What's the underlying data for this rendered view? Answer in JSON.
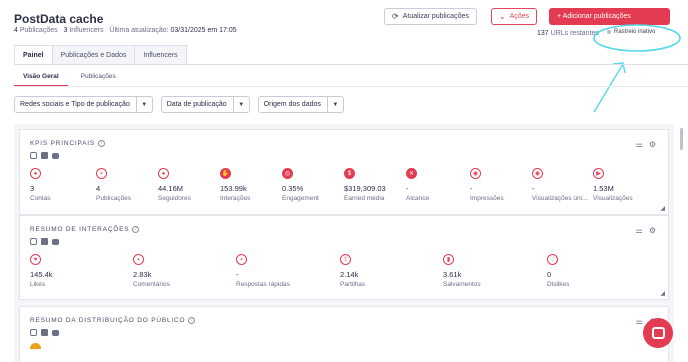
{
  "header": {
    "title": "PostData cache",
    "posts_count": "4",
    "posts_label": "Publicações",
    "influencers_count": "3",
    "influencers_label": "Influencers",
    "last_update_label": "Última atualização:",
    "last_update_value": "03/31/2025 em 17:05"
  },
  "actions": {
    "refresh_label": "Atualizar publicações",
    "actions_label": "Ações",
    "add_label": "+ Adicionar publicações",
    "urls_count": "137",
    "urls_label": "URLs restantes",
    "tracking_label": "Rastreio inativo"
  },
  "tabs": [
    {
      "label": "Painel"
    },
    {
      "label": "Publicações e Dados"
    },
    {
      "label": "Influencers"
    }
  ],
  "subtabs": [
    {
      "label": "Visão Geral"
    },
    {
      "label": "Publicações"
    }
  ],
  "filters": [
    {
      "label": "Redes sociais e Tipo de publicação"
    },
    {
      "label": "Data de publicação"
    },
    {
      "label": "Origem dos dados"
    }
  ],
  "kpis": {
    "title": "KPIS PRINCIPAIS",
    "items": [
      {
        "value": "3",
        "label": "Contas",
        "icon": "person-icon"
      },
      {
        "value": "4",
        "label": "Publicações",
        "icon": "post-icon"
      },
      {
        "value": "44.16M",
        "label": "Seguidores",
        "icon": "followers-icon"
      },
      {
        "value": "153.99k",
        "label": "Interações",
        "icon": "hand-icon"
      },
      {
        "value": "0.35%",
        "label": "Engagement",
        "icon": "target-icon"
      },
      {
        "value": "$319,309.03",
        "label": "Earned media",
        "icon": "dollar-icon"
      },
      {
        "value": "-",
        "label": "Alcance",
        "icon": "reach-icon"
      },
      {
        "value": "-",
        "label": "Impressões",
        "icon": "eye-icon"
      },
      {
        "value": "-",
        "label": "Visualizações úni...",
        "icon": "unique-views-icon"
      },
      {
        "value": "1.53M",
        "label": "Visualizações",
        "icon": "play-icon"
      }
    ]
  },
  "interactions": {
    "title": "RESUMO DE INTERAÇÕES",
    "items": [
      {
        "value": "145.4k",
        "label": "Likes",
        "icon": "heart-icon"
      },
      {
        "value": "2.83k",
        "label": "Comentários",
        "icon": "comment-icon"
      },
      {
        "value": "-",
        "label": "Respostas rápidas",
        "icon": "quick-reply-icon"
      },
      {
        "value": "2.14k",
        "label": "Partilhas",
        "icon": "share-icon"
      },
      {
        "value": "3.61k",
        "label": "Salvamentos",
        "icon": "bookmark-icon"
      },
      {
        "value": "0",
        "label": "Dislikes",
        "icon": "dislike-icon"
      }
    ]
  },
  "audience": {
    "title": "RESUMO DA DISTRIBUIÇÃO DO PÚBLICO"
  },
  "colors": {
    "accent": "#e33b52",
    "text": "#2a2f45",
    "muted": "#6b7086",
    "panel_bg": "#f4f5f8"
  }
}
